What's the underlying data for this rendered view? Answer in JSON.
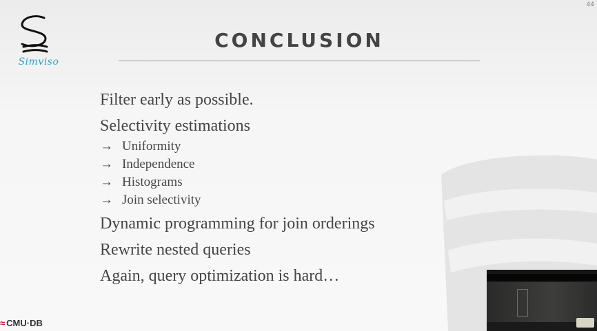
{
  "page_number": "44",
  "logo": {
    "brand": "Simviso",
    "icon": "simviso-s-logo"
  },
  "title": "CONCLUSION",
  "bullets": [
    {
      "text": "Filter early as possible."
    },
    {
      "text": "Selectivity estimations",
      "subs": [
        {
          "arrow": "→",
          "text": "Uniformity"
        },
        {
          "arrow": "→",
          "text": "Independence"
        },
        {
          "arrow": "→",
          "text": "Histograms"
        },
        {
          "arrow": "→",
          "text": "Join selectivity"
        }
      ]
    },
    {
      "text": "Dynamic programming for join orderings"
    },
    {
      "text": "Rewrite nested queries"
    },
    {
      "text": "Again, query optimization is hard…"
    }
  ],
  "footer": {
    "logo_text": "CMU·DB",
    "icon": "cmu-db-logo"
  },
  "video": {
    "icon": "camera-feed"
  },
  "colors": {
    "title": "#444444",
    "text": "#454545",
    "brand": "#2aa3c6",
    "accent": "#c41230"
  }
}
